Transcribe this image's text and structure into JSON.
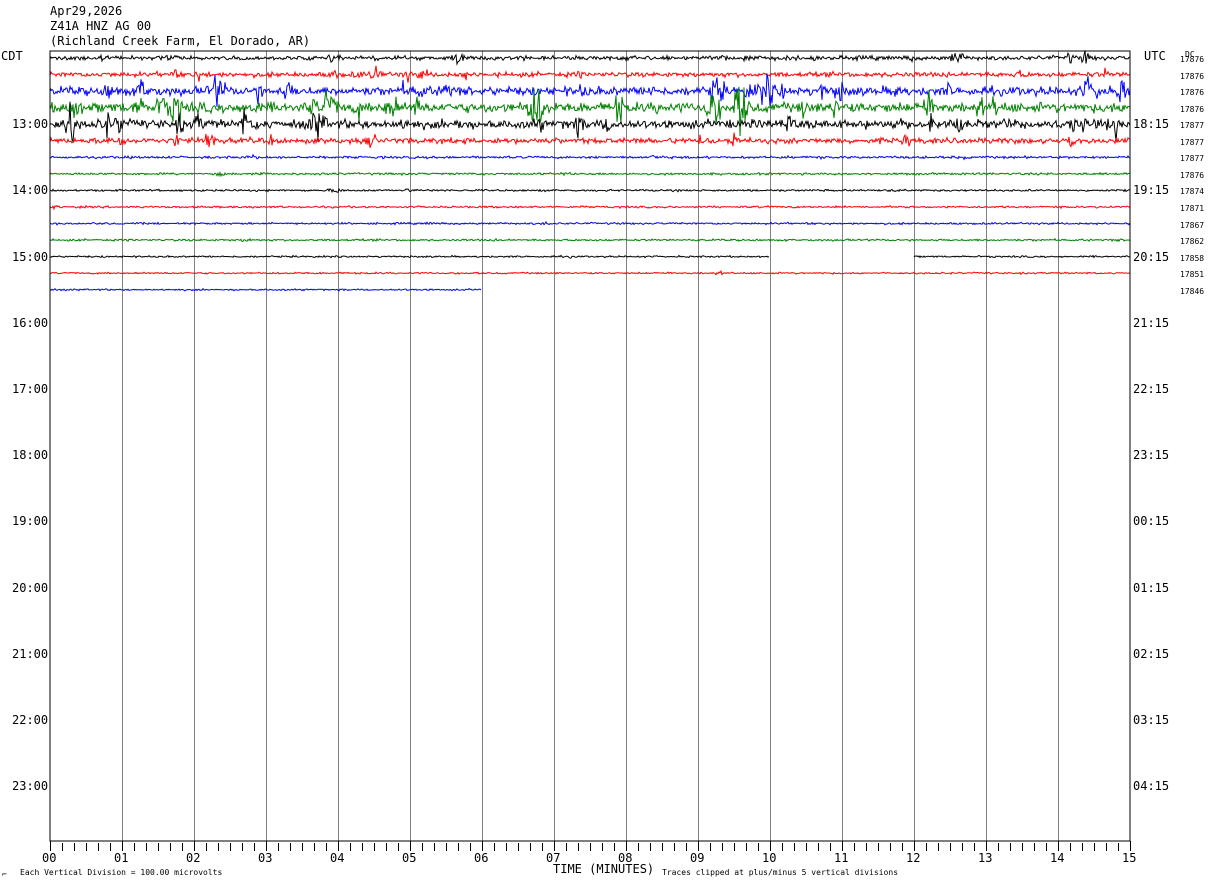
{
  "header": {
    "date": "Apr29,2026",
    "station": "Z41A HNZ AG 00",
    "location": "(Richland Creek Farm, El Dorado, AR)"
  },
  "left_zone": "CDT",
  "right_zone": "UTC",
  "dc_label": "DC",
  "footer": {
    "scale_note": "Each Vertical Division = 100.00 microvolts",
    "clip_note": "Traces clipped at plus/minus 5 vertical divisions",
    "corner_mark": "⌐"
  },
  "colors": {
    "trace_cycle": [
      "#000000",
      "#ff0000",
      "#0000ff",
      "#008000"
    ],
    "grid": "#808080"
  },
  "chart_data": {
    "type": "line",
    "title": "",
    "xlabel": "TIME (MINUTES)",
    "xlim": [
      0,
      15
    ],
    "x_ticks": [
      "00",
      "01",
      "02",
      "03",
      "04",
      "05",
      "06",
      "07",
      "08",
      "09",
      "10",
      "11",
      "12",
      "13",
      "14",
      "15"
    ],
    "rows_per_hour": 4,
    "first_row_minutes_after_hour": 15,
    "left_hour_labels": [
      "13:00",
      "14:00",
      "15:00",
      "16:00",
      "17:00",
      "18:00",
      "19:00",
      "20:00",
      "21:00",
      "22:00",
      "23:00"
    ],
    "right_hour_labels": [
      "18:15",
      "19:15",
      "20:15",
      "21:15",
      "22:15",
      "23:15",
      "00:15",
      "01:15",
      "02:15",
      "03:15",
      "04:15"
    ],
    "grid": true,
    "traces": [
      {
        "dc": "17876",
        "activity": 0.25,
        "gaps": []
      },
      {
        "dc": "17876",
        "activity": 0.3,
        "gaps": []
      },
      {
        "dc": "17876",
        "activity": 0.6,
        "gaps": []
      },
      {
        "dc": "17876",
        "activity": 0.7,
        "gaps": []
      },
      {
        "dc": "17877",
        "activity": 0.6,
        "gaps": []
      },
      {
        "dc": "17877",
        "activity": 0.35,
        "gaps": []
      },
      {
        "dc": "17877",
        "activity": 0.1,
        "gaps": []
      },
      {
        "dc": "17876",
        "activity": 0.08,
        "gaps": []
      },
      {
        "dc": "17874",
        "activity": 0.07,
        "gaps": []
      },
      {
        "dc": "17871",
        "activity": 0.07,
        "gaps": []
      },
      {
        "dc": "17867",
        "activity": 0.07,
        "gaps": []
      },
      {
        "dc": "17862",
        "activity": 0.07,
        "gaps": []
      },
      {
        "dc": "17858",
        "activity": 0.05,
        "gaps": [
          [
            10.0,
            12.0
          ]
        ]
      },
      {
        "dc": "17851",
        "activity": 0.05,
        "gaps": []
      },
      {
        "dc": "17846",
        "activity": 0.05,
        "gaps": [
          [
            6.0,
            15.0
          ]
        ]
      }
    ]
  }
}
